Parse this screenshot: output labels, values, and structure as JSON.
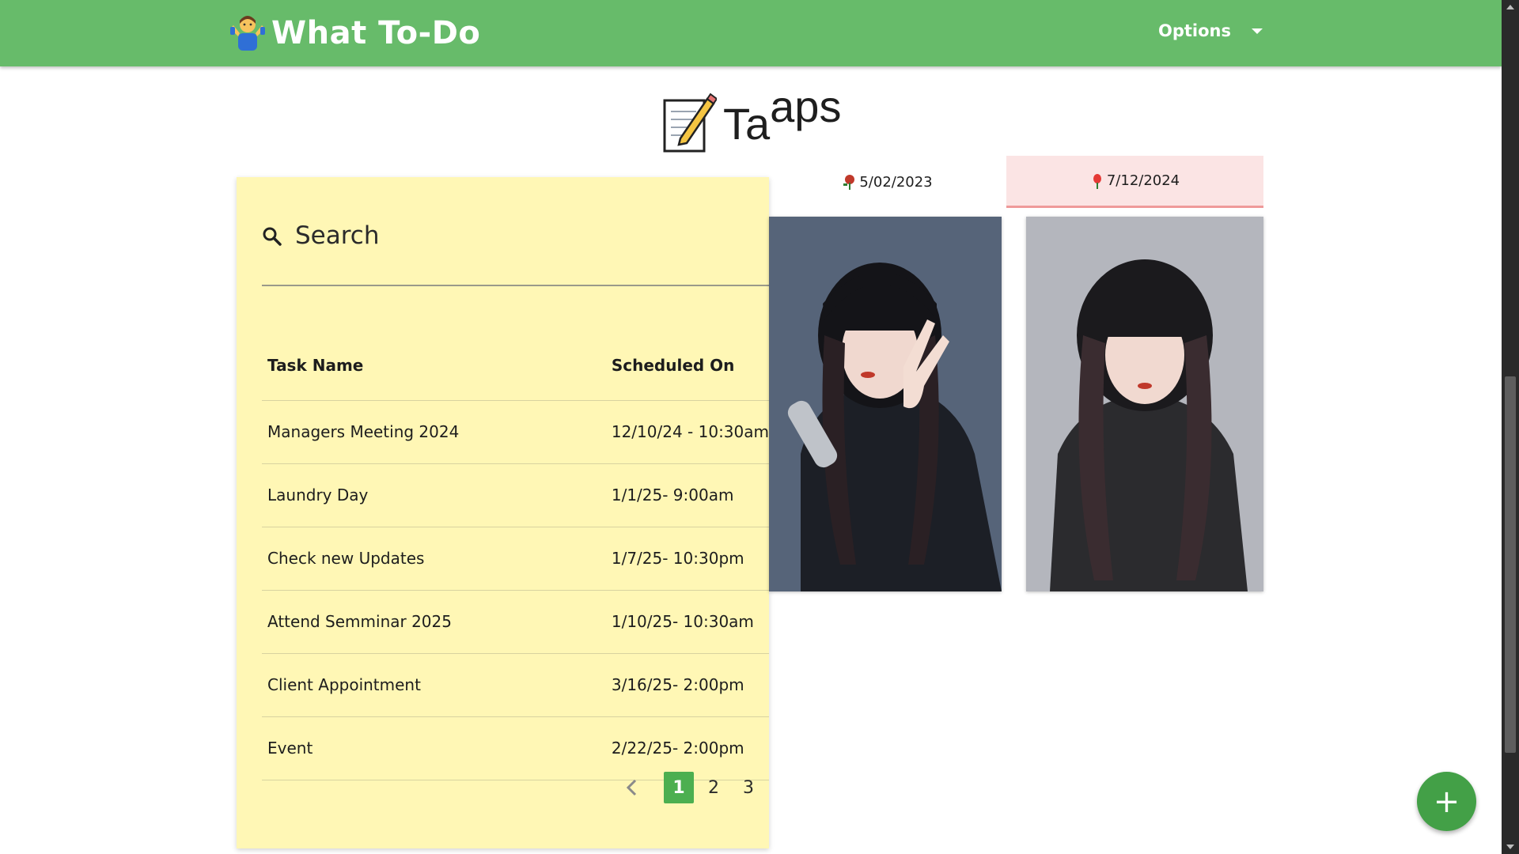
{
  "header": {
    "title": "What To-Do",
    "logo_icon": "person-shrugging-icon",
    "options_label": "Options",
    "bg_color": "#67bb6a"
  },
  "heading": {
    "icon": "memo-icon",
    "text_main": "Ta",
    "text_sup": "aps"
  },
  "search": {
    "placeholder": "Search"
  },
  "table": {
    "headers": [
      "Task Name",
      "Scheduled On"
    ],
    "rows": [
      {
        "name": "Managers Meeting 2024",
        "scheduled": "12/10/24 - 10:30am"
      },
      {
        "name": "Laundry Day",
        "scheduled": "1/1/25- 9:00am"
      },
      {
        "name": "Check new Updates",
        "scheduled": "1/7/25- 10:30pm"
      },
      {
        "name": "Attend Semminar 2025",
        "scheduled": "1/10/25- 10:30am"
      },
      {
        "name": "Client Appointment",
        "scheduled": "3/16/25- 2:00pm"
      },
      {
        "name": "Event",
        "scheduled": "2/22/25- 2:00pm"
      }
    ]
  },
  "pagination": {
    "pages": [
      "1",
      "2",
      "3"
    ],
    "current": "1"
  },
  "date_tabs": [
    {
      "label": "5/02/2023",
      "icon": "flower-icon"
    },
    {
      "label": "7/12/2024",
      "icon": "rose-icon",
      "active": true
    }
  ],
  "fab": {
    "label": "+"
  },
  "colors": {
    "card_bg": "#fff7b5",
    "accent": "#43a047",
    "active_tab_bg": "#fbe4e4"
  }
}
